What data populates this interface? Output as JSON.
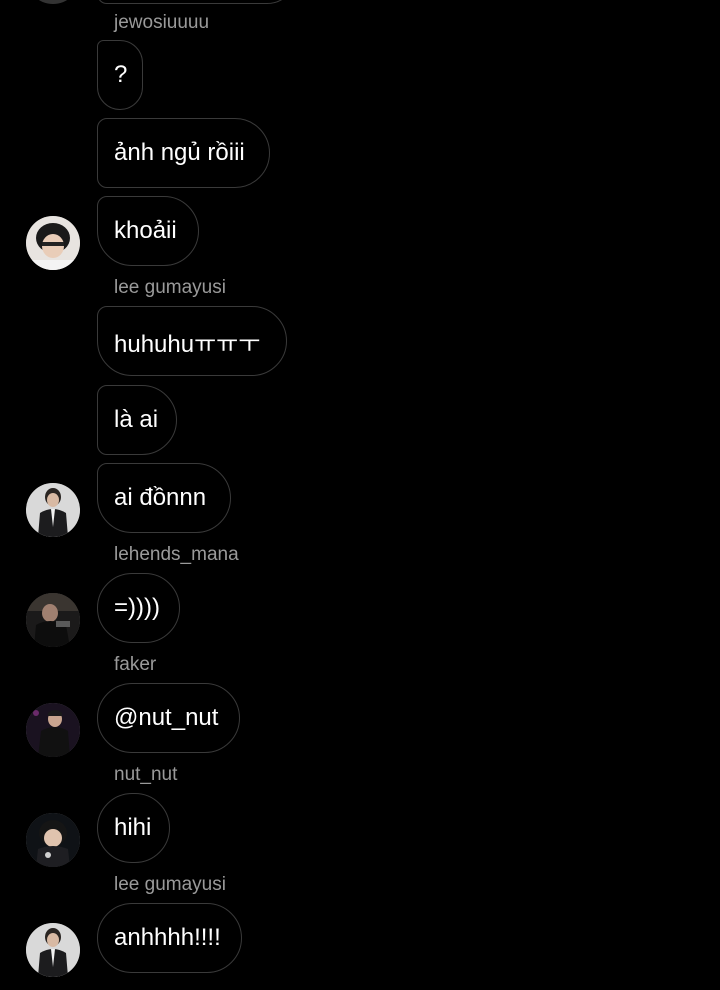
{
  "chat": {
    "groups": [
      {
        "sender": "jewosiuuuu",
        "messages": [
          "?",
          "ảnh ngủ rồiii",
          "khoảii"
        ]
      },
      {
        "sender": "lee gumayusi",
        "messages": [
          "huhuhuㅠㅠㅜ",
          "là ai",
          "ai đồnnn"
        ]
      },
      {
        "sender": "lehends_mana",
        "messages": [
          "=))))"
        ]
      },
      {
        "sender": "faker",
        "messages": [
          "@nut_nut"
        ]
      },
      {
        "sender": "nut_nut",
        "messages": [
          "hihi"
        ]
      },
      {
        "sender": "lee gumayusi",
        "messages": [
          "anhhhh!!!!"
        ]
      }
    ]
  }
}
